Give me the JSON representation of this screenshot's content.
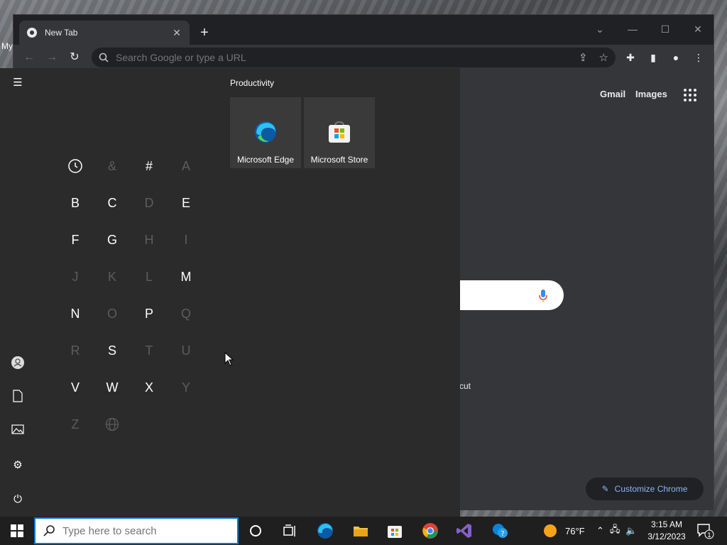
{
  "desktop": {
    "label": "My"
  },
  "browser": {
    "tab": {
      "title": "New Tab",
      "close": "✕"
    },
    "omnibox": {
      "placeholder": "Search Google or type a URL"
    },
    "links": {
      "gmail": "Gmail",
      "images": "Images"
    },
    "shortcut_fragment": "cut",
    "customize_label": "Customize Chrome"
  },
  "start_menu": {
    "letters": [
      {
        "t": "clock",
        "dim": false
      },
      {
        "t": "&",
        "dim": true
      },
      {
        "t": "#",
        "dim": false
      },
      {
        "t": "A",
        "dim": true
      },
      {
        "t": "B",
        "dim": false
      },
      {
        "t": "C",
        "dim": false
      },
      {
        "t": "D",
        "dim": true
      },
      {
        "t": "E",
        "dim": false
      },
      {
        "t": "F",
        "dim": false
      },
      {
        "t": "G",
        "dim": false
      },
      {
        "t": "H",
        "dim": true
      },
      {
        "t": "I",
        "dim": true
      },
      {
        "t": "J",
        "dim": true
      },
      {
        "t": "K",
        "dim": true
      },
      {
        "t": "L",
        "dim": true
      },
      {
        "t": "M",
        "dim": false
      },
      {
        "t": "N",
        "dim": false
      },
      {
        "t": "O",
        "dim": true
      },
      {
        "t": "P",
        "dim": false
      },
      {
        "t": "Q",
        "dim": true
      },
      {
        "t": "R",
        "dim": true
      },
      {
        "t": "S",
        "dim": false
      },
      {
        "t": "T",
        "dim": true
      },
      {
        "t": "U",
        "dim": true
      },
      {
        "t": "V",
        "dim": false
      },
      {
        "t": "W",
        "dim": false
      },
      {
        "t": "X",
        "dim": false
      },
      {
        "t": "Y",
        "dim": true
      },
      {
        "t": "Z",
        "dim": true
      },
      {
        "t": "globe",
        "dim": true
      }
    ],
    "group_title": "Productivity",
    "tiles": [
      {
        "label": "Microsoft Edge",
        "icon": "edge-icon"
      },
      {
        "label": "Microsoft Store",
        "icon": "store-icon"
      }
    ]
  },
  "taskbar": {
    "search_placeholder": "Type here to search",
    "weather": "76°F",
    "time": "3:15 AM",
    "date": "3/12/2023",
    "notification_count": "1"
  },
  "colors": {
    "accent": "#0078d4",
    "start_bg": "#2b2b2b",
    "chrome_bg": "#35363a",
    "link": "#8ab4f8"
  }
}
